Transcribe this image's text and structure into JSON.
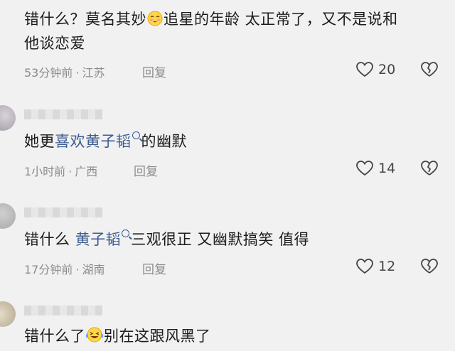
{
  "comments": [
    {
      "text_parts": [
        "错什么？莫名其妙",
        "追星的年龄 太正常了，又不是说和"
      ],
      "text_line2": "他谈恋爱",
      "time": "53分钟前",
      "location": "江苏",
      "reply_label": "回复",
      "likes": "20"
    },
    {
      "text_before": "她更",
      "link1": "喜欢",
      "link2": "黄子韬",
      "text_after": "的幽默",
      "time": "1小时前",
      "location": "广西",
      "reply_label": "回复",
      "likes": "14"
    },
    {
      "text_before": "错什么 ",
      "link": "黄子韬",
      "text_after": "三观很正 又幽默搞笑 值得",
      "time": "17分钟前",
      "location": "湖南",
      "reply_label": "回复",
      "likes": "12"
    },
    {
      "text_before": "错什么了",
      "text_after": "别在这跟风黑了"
    }
  ],
  "icons": {
    "like": "heart-outline-icon",
    "dislike": "broken-heart-icon",
    "search": "search-mark-icon",
    "emoji_shy": "shy-face-emoji",
    "emoji_laugh": "laughing-tears-emoji"
  },
  "colors": {
    "background": "#f1f1f1",
    "link": "#3b5b8f",
    "meta": "#8c8c8c"
  }
}
